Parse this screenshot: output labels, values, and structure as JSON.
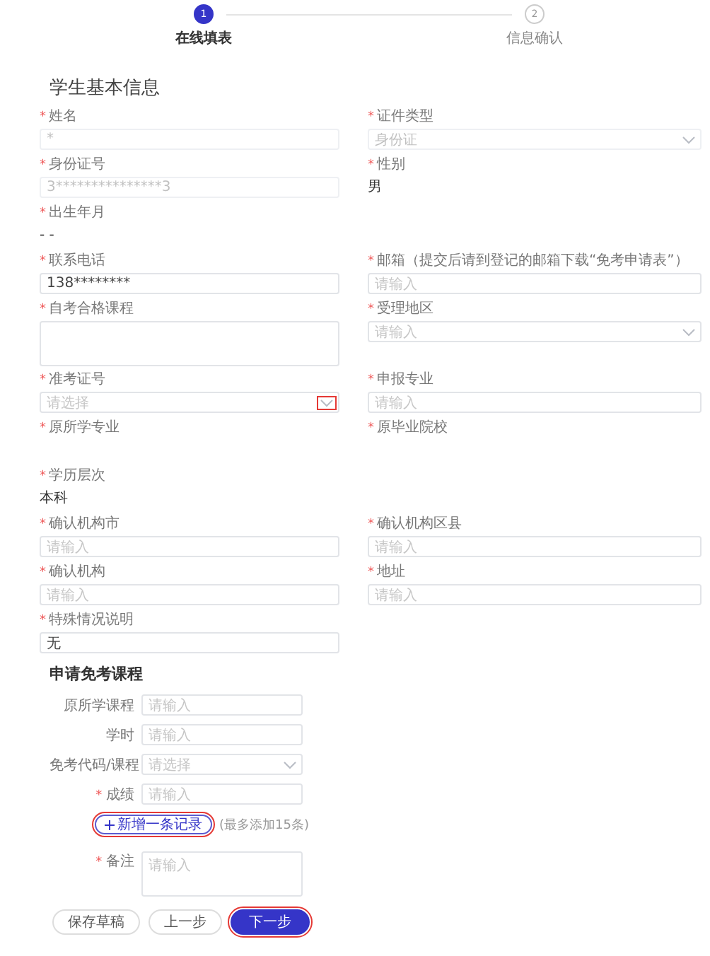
{
  "steps": [
    {
      "number": "1",
      "label": "在线填表",
      "selected": true
    },
    {
      "number": "2",
      "label": "信息确认",
      "selected": false
    }
  ],
  "section_title": "学生基本信息",
  "rows": [
    [
      {
        "kind": "input",
        "label": "姓名",
        "required": true,
        "value": "*",
        "disabled": true
      },
      {
        "kind": "select",
        "label": "证件类型",
        "required": true,
        "value": "身份证",
        "disabled": true,
        "highlighted": false
      }
    ],
    [
      {
        "kind": "input",
        "label": "身份证号",
        "required": true,
        "value": "3***************3",
        "disabled": true
      },
      {
        "kind": "text",
        "label": "性别",
        "required": true,
        "value": "男"
      }
    ],
    [
      {
        "kind": "text",
        "label": "出生年月",
        "required": true,
        "value": "- -"
      }
    ],
    [
      {
        "kind": "input",
        "label": "联系电话",
        "required": true,
        "value": "138********",
        "disabled": false
      },
      {
        "kind": "input",
        "label": "邮箱（提交后请到登记的邮箱下载“免考申请表”）",
        "required": true,
        "placeholder": "请输入",
        "disabled": false
      }
    ],
    [
      {
        "kind": "textarea",
        "label": "自考合格课程",
        "required": true
      },
      {
        "kind": "select",
        "label": "受理地区",
        "required": true,
        "placeholder": "请输入",
        "disabled": false,
        "highlighted": false
      }
    ],
    [
      {
        "kind": "select",
        "label": "准考证号",
        "required": true,
        "placeholder": "请选择",
        "disabled": false,
        "highlighted": true
      },
      {
        "kind": "input",
        "label": "申报专业",
        "required": true,
        "placeholder": "请输入",
        "disabled": false
      }
    ],
    [
      {
        "kind": "text",
        "label": "原所学专业",
        "required": true
      },
      {
        "kind": "text",
        "label": "原毕业院校",
        "required": true
      }
    ],
    [
      {
        "kind": "text",
        "label": "学历层次",
        "required": true,
        "value": "本科"
      }
    ],
    [
      {
        "kind": "input",
        "label": "确认机构市",
        "required": true,
        "placeholder": "请输入",
        "disabled": false
      },
      {
        "kind": "input",
        "label": "确认机构区县",
        "required": true,
        "placeholder": "请输入",
        "disabled": false
      }
    ],
    [
      {
        "kind": "input",
        "label": "确认机构",
        "required": true,
        "placeholder": "请输入",
        "disabled": false
      },
      {
        "kind": "input",
        "label": "地址",
        "required": true,
        "placeholder": "请输入",
        "disabled": false
      }
    ],
    [
      {
        "kind": "input",
        "label": "特殊情况说明",
        "required": true,
        "value": "无",
        "disabled": false
      }
    ]
  ],
  "course_section": {
    "title": "申请免考课程",
    "fields": [
      {
        "kind": "input",
        "label": "原所学课程",
        "required": false,
        "placeholder": "请输入"
      },
      {
        "kind": "input",
        "label": "学时",
        "required": false,
        "placeholder": "请输入"
      },
      {
        "kind": "select",
        "label": "免考代码/课程",
        "required": false,
        "placeholder": "请选择"
      },
      {
        "kind": "input",
        "label": "成绩",
        "required": true,
        "placeholder": "请输入"
      }
    ],
    "add_button": {
      "label": "新增一条记录",
      "highlighted": true
    },
    "add_hint": "(最多添加15条)",
    "remarks": {
      "kind": "textarea",
      "label": "备注",
      "required": true,
      "placeholder": "请输入"
    }
  },
  "buttons": [
    {
      "label": "保存草稿",
      "kind": "outline",
      "highlighted": false
    },
    {
      "label": "上一步",
      "kind": "outline",
      "highlighted": false
    },
    {
      "label": "下一步",
      "kind": "primary",
      "highlighted": true
    }
  ]
}
